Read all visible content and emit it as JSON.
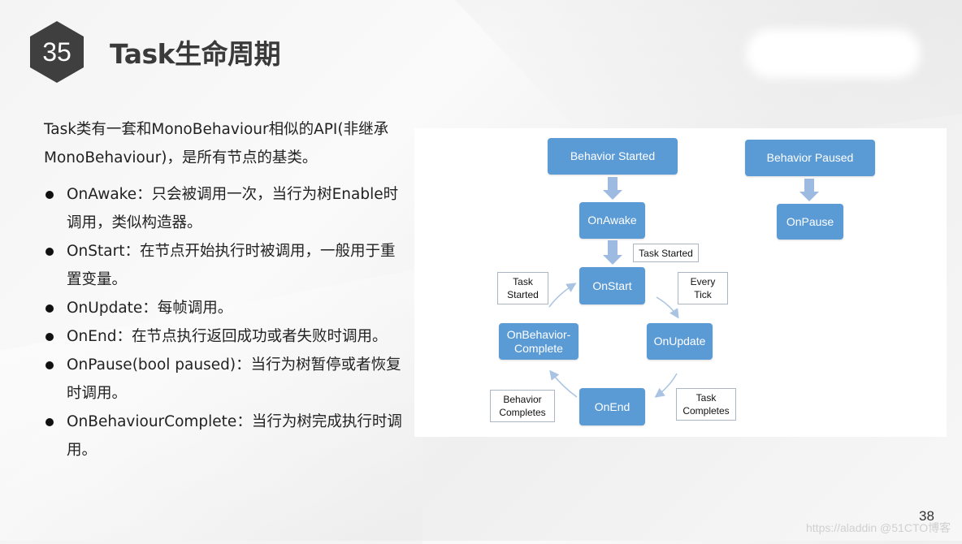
{
  "slide": {
    "section_number": "35",
    "title": "Task生命周期",
    "page_number": "38",
    "watermark": "https://aladdin @51CTO博客"
  },
  "content": {
    "intro": "Task类有一套和MonoBehaviour相似的API(非继承MonoBehaviour)，是所有节点的基类。",
    "bullets": [
      {
        "text": "OnAwake：只会被调用一次，当行为树Enable时调用，类似构造器。"
      },
      {
        "text": "OnStart：在节点开始执行时被调用，一般用于重置变量。"
      },
      {
        "text": "OnUpdate：每帧调用。"
      },
      {
        "text": "OnEnd：在节点执行返回成功或者失败时调用。"
      },
      {
        "text": "OnPause(bool paused)：当行为树暂停或者恢复时调用。"
      },
      {
        "text": "OnBehaviourComplete：当行为树完成执行时调用。"
      }
    ]
  },
  "diagram": {
    "colors": {
      "node": "#5b9bd5",
      "arrow": "#9dbbe0",
      "curve": "#a9c4e2"
    },
    "nodes": {
      "behavior_started": "Behavior Started",
      "on_awake": "OnAwake",
      "on_start": "OnStart",
      "on_update": "OnUpdate",
      "on_end": "OnEnd",
      "on_behavior_complete_1": "OnBehavior-",
      "on_behavior_complete_2": "Complete",
      "behavior_paused": "Behavior Paused",
      "on_pause": "OnPause"
    },
    "notes": {
      "task_started_top": "Task Started",
      "task_started_left_1": "Task",
      "task_started_left_2": "Started",
      "every_tick_1": "Every",
      "every_tick_2": "Tick",
      "task_completes_1": "Task",
      "task_completes_2": "Completes",
      "behavior_completes_1": "Behavior",
      "behavior_completes_2": "Completes"
    }
  }
}
